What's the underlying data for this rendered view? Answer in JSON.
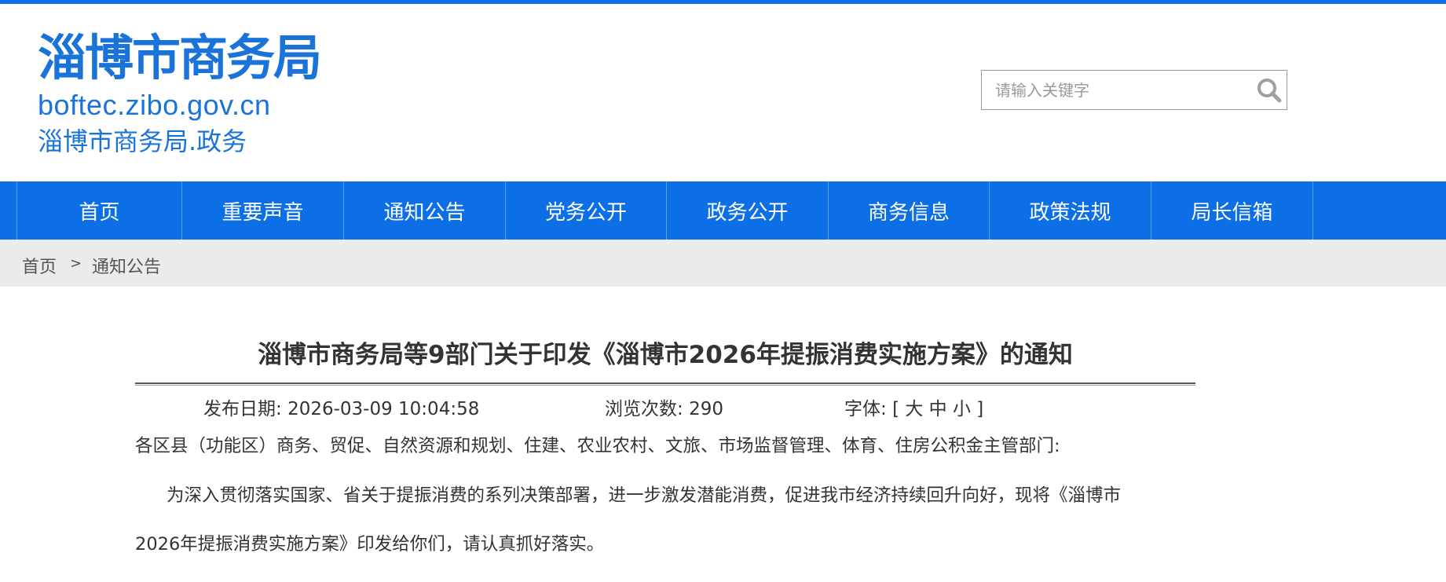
{
  "header": {
    "logo_title": "淄博市商务局",
    "logo_domain": "boftec.zibo.gov.cn",
    "logo_sub": "淄博市商务局.政务",
    "search_placeholder": "请输入关键字"
  },
  "nav": {
    "items": [
      "首页",
      "重要声音",
      "通知公告",
      "党务公开",
      "政务公开",
      "商务信息",
      "政策法规",
      "局长信箱"
    ]
  },
  "breadcrumb": {
    "home": "首页",
    "separator": ">",
    "current": "通知公告"
  },
  "article": {
    "title": "淄博市商务局等9部门关于印发《淄博市2026年提振消费实施方案》的通知",
    "publish_label": "发布日期:",
    "publish_date": "2026-03-09 10:04:58",
    "views_label": "浏览次数:",
    "views": "290",
    "font_label": "字体:",
    "font_open": "[",
    "font_large": "大",
    "font_medium": "中",
    "font_small": "小",
    "font_close": "]",
    "recipients": "各区县（功能区）商务、贸促、自然资源和规划、住建、农业农村、文旅、市场监督管理、体育、住房公积金主管部门:",
    "body_line1": "为深入贯彻落实国家、省关于提振消费的系列决策部署，进一步激发潜能消费，促进我市经济持续回升向好，现将《淄博市",
    "body_line2": "2026年提振消费实施方案》印发给你们，请认真抓好落实。"
  },
  "colors": {
    "brand_blue": "#0d6fe6",
    "logo_blue": "#1a73d9",
    "crumb_bg": "#ebebeb",
    "text": "#333333"
  },
  "icons": {
    "search": "search-icon"
  }
}
